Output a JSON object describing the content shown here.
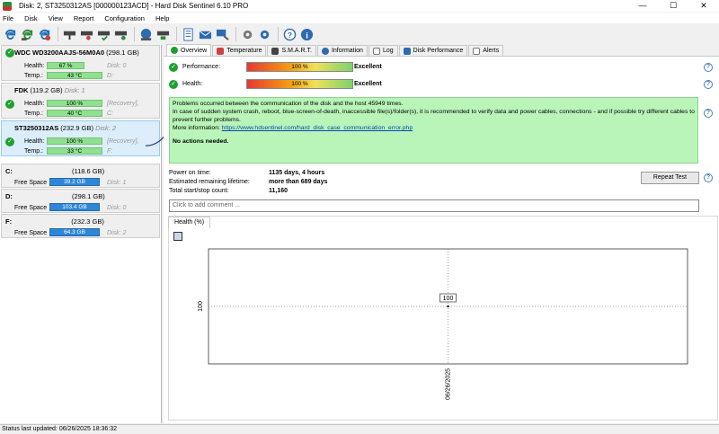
{
  "window": {
    "title": "Disk: 2, ST3250312AS [000000123ACD]  -  Hard Disk Sentinel 6.10 PRO",
    "minimize_glyph": "—",
    "maximize_glyph": "☐",
    "close_glyph": "✕"
  },
  "menu": [
    "File",
    "Disk",
    "View",
    "Report",
    "Configuration",
    "Help"
  ],
  "disks": [
    {
      "name": "WDC WD3200AAJS-56M0A0",
      "size": "(298.1 GB)",
      "disk_no": "Disk: 0",
      "health_label": "Health:",
      "health": "67 %",
      "health_pct": 67,
      "temp_label": "Temp.:",
      "temp": "43 °C",
      "volume_note": "D:",
      "recovery_note": ""
    },
    {
      "name": "FDK",
      "size": "(119.2 GB)",
      "disk_no": "Disk: 1",
      "health_label": "Health:",
      "health": "100 %",
      "health_pct": 100,
      "temp_label": "Temp.:",
      "temp": "40 °C",
      "volume_note": "C:",
      "recovery_note": "[Recovery],"
    },
    {
      "name": "ST3250312AS",
      "size": "(232.9 GB)",
      "disk_no": "Disk: 2",
      "health_label": "Health:",
      "health": "100 %",
      "health_pct": 100,
      "temp_label": "Temp.:",
      "temp": "33 °C",
      "volume_note": "F:",
      "recovery_note": "[Recovery],"
    }
  ],
  "volumes": [
    {
      "letter": "C:",
      "size": "(118.6 GB)",
      "free_label": "Free Space",
      "free": "39.2 GB",
      "disk": "Disk: 1"
    },
    {
      "letter": "D:",
      "size": "(298.1 GB)",
      "free_label": "Free Space",
      "free": "103.4 GB",
      "disk": "Disk: 0"
    },
    {
      "letter": "F:",
      "size": "(232.3 GB)",
      "free_label": "Free Space",
      "free": "64.3 GB",
      "disk": "Disk: 2"
    }
  ],
  "tabs": [
    "Overview",
    "Temperature",
    "S.M.A.R.T.",
    "Information",
    "Log",
    "Disk Performance",
    "Alerts"
  ],
  "overview": {
    "performance_label": "Performance:",
    "performance_value": "100 %",
    "performance_rating": "Excellent",
    "health_label": "Health:",
    "health_value": "100 %",
    "health_rating": "Excellent",
    "message_line1": "Problems occurred between the communication of the disk and the host 45949 times.",
    "message_line2": "In case of sudden system crash, reboot, blue-screen-of-death, inaccessible file(s)/folder(s), it is recommended to verify data and power cables, connections - and if possible try different cables to prevent further problems.",
    "more_info_label": "More information:",
    "more_info_link": "https://www.hdsentinel.com/hard_disk_case_communication_error.php",
    "no_actions": "No actions needed.",
    "power_on_label": "Power on time:",
    "power_on_value": "1135 days, 4 hours",
    "remaining_label": "Estimated remaining lifetime:",
    "remaining_value": "more than 689 days",
    "startstop_label": "Total start/stop count:",
    "startstop_value": "11,160",
    "repeat_test": "Repeat Test",
    "comment_placeholder": "Click to add comment ..."
  },
  "chart_tab": "Health (%)",
  "chart_data": {
    "type": "line",
    "title": "",
    "xlabel": "",
    "ylabel": "",
    "x": [
      "06/26/2025"
    ],
    "series": [
      {
        "name": "Health (%)",
        "values": [
          100
        ]
      }
    ],
    "y_tick": "100",
    "point_label": "100",
    "grid": "dotted crosshair"
  },
  "status_bar": "Status last updated: 06/26/2025 18:36:32"
}
